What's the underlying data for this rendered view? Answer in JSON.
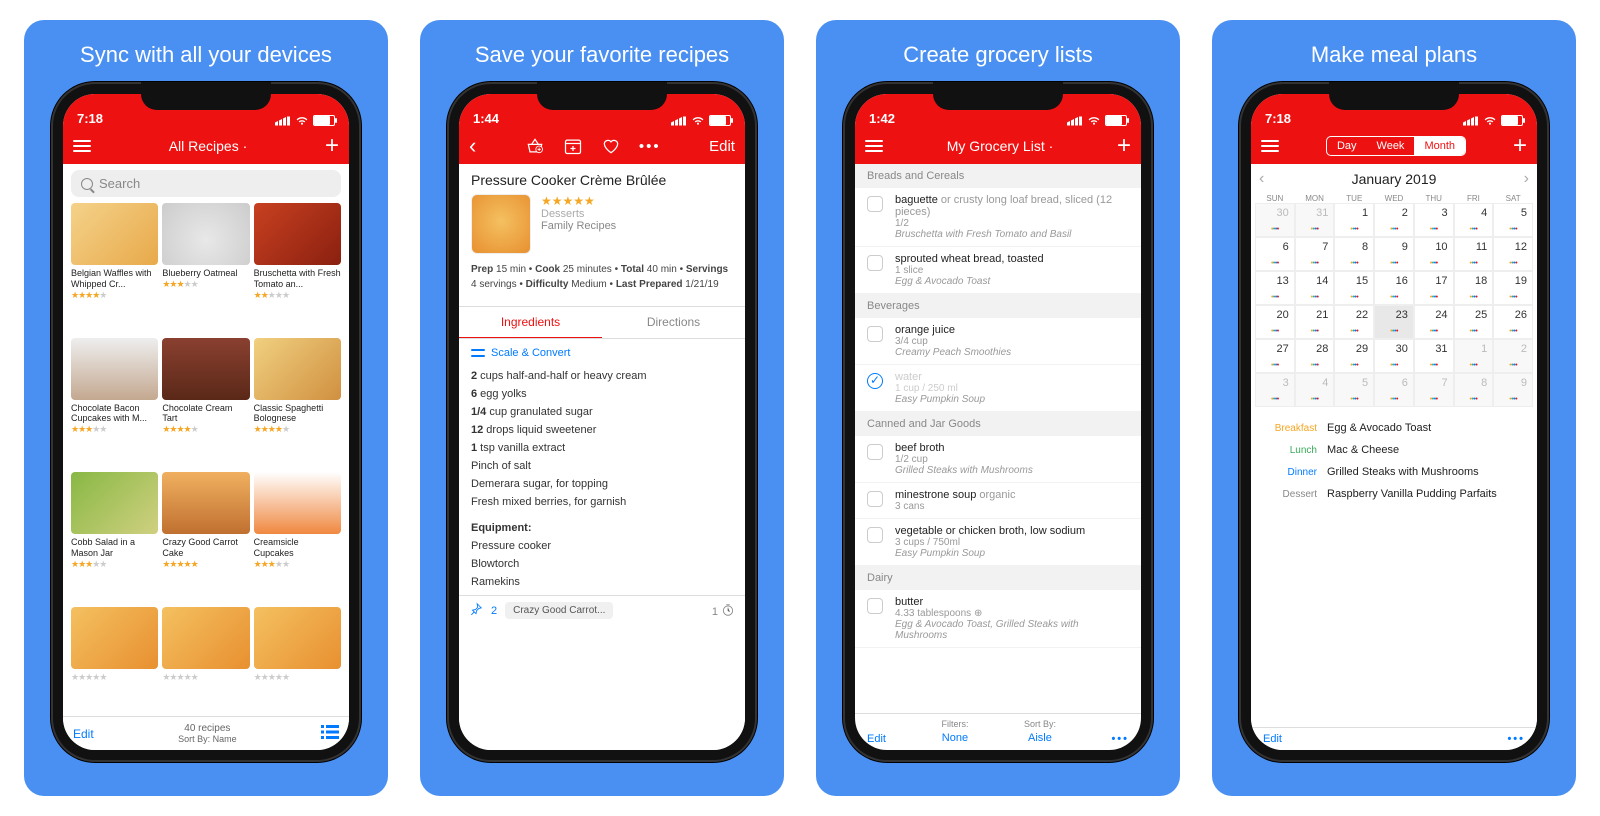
{
  "panels": [
    "Sync with all your devices",
    "Save your favorite recipes",
    "Create grocery lists",
    "Make meal plans"
  ],
  "p1": {
    "time": "7:18",
    "title": "All Recipes ·",
    "searchPlaceholder": "Search",
    "editLabel": "Edit",
    "countLabel": "40 recipes",
    "sortLabel": "Sort By: Name",
    "items": [
      {
        "name": "Belgian Waffles with Whipped Cr...",
        "rating": 4,
        "css": "waffle"
      },
      {
        "name": "Blueberry Oatmeal",
        "rating": 3,
        "css": "oatmeal"
      },
      {
        "name": "Bruschetta with Fresh Tomato an...",
        "rating": 2,
        "css": "bruschetta"
      },
      {
        "name": "Chocolate Bacon Cupcakes with M...",
        "rating": 3,
        "css": "cupcake"
      },
      {
        "name": "Chocolate Cream Tart",
        "rating": 4,
        "css": "cake"
      },
      {
        "name": "Classic Spaghetti Bolognese",
        "rating": 4,
        "css": "spaghetti"
      },
      {
        "name": "Cobb Salad in a Mason Jar",
        "rating": 3,
        "css": "salad"
      },
      {
        "name": "Crazy Good Carrot Cake",
        "rating": 5,
        "css": "carrot"
      },
      {
        "name": "Creamsicle Cupcakes",
        "rating": 3,
        "css": "creamsicle"
      },
      {
        "name": "",
        "rating": 0,
        "css": "generic"
      },
      {
        "name": "",
        "rating": 0,
        "css": "generic"
      },
      {
        "name": "",
        "rating": 0,
        "css": "generic"
      }
    ]
  },
  "p2": {
    "time": "1:44",
    "editLabel": "Edit",
    "title": "Pressure Cooker Crème Brûlée",
    "category": "Desserts",
    "source": "Family Recipes",
    "infoLine1": "Prep 15 min • Cook 25 minutes • Total 40 min •",
    "infoLine2": "Servings 4 servings • Difficulty Medium • Last Prepared 1/21/19",
    "tabIngredients": "Ingredients",
    "tabDirections": "Directions",
    "scaleLabel": "Scale & Convert",
    "ingredients": [
      {
        "qty": "2",
        "rest": "cups half-and-half or heavy cream"
      },
      {
        "qty": "6",
        "rest": "egg yolks"
      },
      {
        "qty": "1/4",
        "rest": "cup granulated sugar"
      },
      {
        "qty": "12",
        "rest": "drops liquid sweetener"
      },
      {
        "qty": "1",
        "rest": "tsp vanilla extract"
      },
      {
        "qty": "",
        "rest": "Pinch of salt"
      },
      {
        "qty": "",
        "rest": "Demerara sugar, for topping"
      },
      {
        "qty": "",
        "rest": "Fresh mixed berries, for garnish"
      }
    ],
    "equipLabel": "Equipment:",
    "equipment": [
      "Pressure cooker",
      "Blowtorch",
      "Ramekins"
    ],
    "pinnedCount": "2",
    "pinnedChip": "Crazy Good Carrot...",
    "timerCount": "1"
  },
  "p3": {
    "time": "1:42",
    "title": "My Grocery List ·",
    "editLabel": "Edit",
    "filtersLabel": "Filters:",
    "filtersValue": "None",
    "sortLabel": "Sort By:",
    "sortValue": "Aisle",
    "sections": [
      {
        "name": "Breads and Cereals",
        "items": [
          {
            "name": "baguette",
            "note": "or crusty long loaf bread, sliced (12 pieces)",
            "qty": "1/2",
            "src": "Bruschetta with Fresh Tomato and Basil",
            "done": false
          },
          {
            "name": "sprouted wheat bread, toasted",
            "note": "",
            "qty": "1 slice",
            "src": "Egg & Avocado Toast",
            "done": false
          }
        ]
      },
      {
        "name": "Beverages",
        "items": [
          {
            "name": "orange juice",
            "note": "",
            "qty": "3/4 cup",
            "src": "Creamy Peach Smoothies",
            "done": false
          },
          {
            "name": "water",
            "note": "",
            "qty": "1 cup / 250 ml",
            "src": "Easy Pumpkin Soup",
            "done": true
          }
        ]
      },
      {
        "name": "Canned and Jar Goods",
        "items": [
          {
            "name": "beef broth",
            "note": "",
            "qty": "1/2 cup",
            "src": "Grilled Steaks with Mushrooms",
            "done": false
          },
          {
            "name": "minestrone soup",
            "note": "organic",
            "qty": "3 cans",
            "src": "",
            "done": false
          },
          {
            "name": "vegetable or chicken broth, low sodium",
            "note": "",
            "qty": "3 cups / 750ml",
            "src": "Easy Pumpkin Soup",
            "done": false
          }
        ]
      },
      {
        "name": "Dairy",
        "items": [
          {
            "name": "butter",
            "note": "",
            "qty": "4.33 tablespoons ⊕",
            "src": "Egg & Avocado Toast, Grilled Steaks with Mushrooms",
            "done": false
          }
        ]
      }
    ]
  },
  "p4": {
    "time": "7:18",
    "segDay": "Day",
    "segWeek": "Week",
    "segMonth": "Month",
    "month": "January 2019",
    "dow": [
      "SUN",
      "MON",
      "TUE",
      "WED",
      "THU",
      "FRI",
      "SAT"
    ],
    "editLabel": "Edit",
    "days": [
      {
        "n": 30,
        "om": true
      },
      {
        "n": 31,
        "om": true
      },
      {
        "n": 1
      },
      {
        "n": 2
      },
      {
        "n": 3
      },
      {
        "n": 4
      },
      {
        "n": 5
      },
      {
        "n": 6
      },
      {
        "n": 7
      },
      {
        "n": 8
      },
      {
        "n": 9
      },
      {
        "n": 10
      },
      {
        "n": 11
      },
      {
        "n": 12
      },
      {
        "n": 13
      },
      {
        "n": 14
      },
      {
        "n": 15
      },
      {
        "n": 16
      },
      {
        "n": 17
      },
      {
        "n": 18
      },
      {
        "n": 19
      },
      {
        "n": 20
      },
      {
        "n": 21
      },
      {
        "n": 22
      },
      {
        "n": 23,
        "today": true
      },
      {
        "n": 24
      },
      {
        "n": 25
      },
      {
        "n": 26
      },
      {
        "n": 27
      },
      {
        "n": 28
      },
      {
        "n": 29
      },
      {
        "n": 30
      },
      {
        "n": 31
      },
      {
        "n": 1,
        "om": true
      },
      {
        "n": 2,
        "om": true
      },
      {
        "n": 3,
        "om": true
      },
      {
        "n": 4,
        "om": true
      },
      {
        "n": 5,
        "om": true
      },
      {
        "n": 6,
        "om": true
      },
      {
        "n": 7,
        "om": true
      },
      {
        "n": 8,
        "om": true
      },
      {
        "n": 9,
        "om": true
      }
    ],
    "meals": [
      {
        "label": "Breakfast",
        "css": "breakfast",
        "value": "Egg & Avocado Toast"
      },
      {
        "label": "Lunch",
        "css": "lunch",
        "value": "Mac & Cheese"
      },
      {
        "label": "Dinner",
        "css": "dinner",
        "value": "Grilled Steaks with Mushrooms"
      },
      {
        "label": "Dessert",
        "css": "dessert",
        "value": "Raspberry Vanilla Pudding Parfaits"
      }
    ]
  }
}
